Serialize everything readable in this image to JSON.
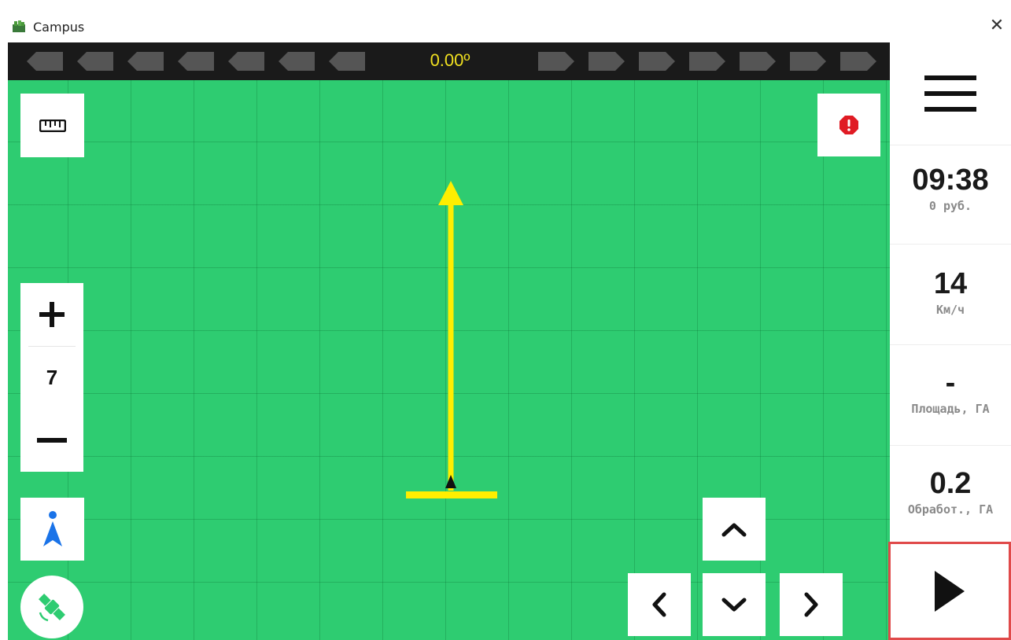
{
  "window": {
    "title": "Campus",
    "close_label": "✕"
  },
  "heading": {
    "value": "0.00º"
  },
  "map": {
    "zoom_level": "7",
    "colors": {
      "field": "#2ecc71",
      "track": "#ffee00"
    }
  },
  "sidebar": {
    "time": {
      "value": "09:38",
      "label": "0 руб."
    },
    "speed": {
      "value": "14",
      "label": "Км/ч"
    },
    "area": {
      "value": "-",
      "label": "Площадь, ГА"
    },
    "processed": {
      "value": "0.2",
      "label": "Обработ., ГА"
    }
  },
  "icons": {
    "ruler": "ruler-icon",
    "alert": "alert-icon",
    "locate": "locate-icon",
    "satellite": "satellite-icon",
    "menu": "hamburger-icon",
    "play": "play-icon"
  }
}
